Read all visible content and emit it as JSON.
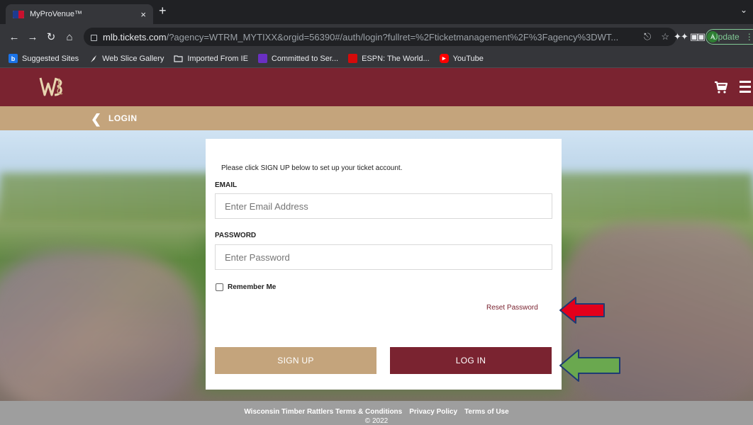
{
  "browser": {
    "tab_title": "MyProVenue™",
    "tab_close": "×",
    "new_tab": "+",
    "tab_menu": "⌄",
    "url_host": "mlb.tickets.com",
    "url_rest": "/?agency=WTRM_MYTIXX&orgid=56390#/auth/login?fullret=%2Fticketmanagement%2F%3Fagency%3DWT...",
    "profile_initial": "A",
    "update_label": "Update",
    "update_menu": "⋮",
    "bookmarks": [
      {
        "label": "Suggested Sites",
        "icon": "bing-icon",
        "color": "#1a73e8",
        "glyph": "b"
      },
      {
        "label": "Web Slice Gallery",
        "icon": "web-slice-icon",
        "color": "transparent",
        "glyph": ""
      },
      {
        "label": "Imported From IE",
        "icon": "folder-icon",
        "color": "transparent",
        "glyph": ""
      },
      {
        "label": "Committed to Ser...",
        "icon": "site-icon",
        "color": "#6a2fc2",
        "glyph": ""
      },
      {
        "label": "ESPN: The World...",
        "icon": "espn-icon",
        "color": "#d50a0a",
        "glyph": ""
      },
      {
        "label": "YouTube",
        "icon": "youtube-icon",
        "color": "#ff0000",
        "glyph": "▸"
      }
    ]
  },
  "site": {
    "brand_color": "#7a2330",
    "accent_color": "#c4a47c",
    "login_bar_title": "LOGIN"
  },
  "form": {
    "intro": "Please click SIGN UP below to set up your ticket account.",
    "email_label": "EMAIL",
    "email_placeholder": "Enter Email Address",
    "password_label": "PASSWORD",
    "password_placeholder": "Enter Password",
    "remember_label": "Remember Me",
    "reset_link": "Reset Password",
    "signup_label": "SIGN UP",
    "login_label": "LOG IN"
  },
  "footer": {
    "links": [
      "Wisconsin Timber Rattlers Terms & Conditions",
      "Privacy Policy",
      "Terms of Use"
    ],
    "copyright": "© 2022"
  },
  "annotations": {
    "red_arrow_color": "#e3001b",
    "green_arrow_color": "#6aa84f"
  }
}
